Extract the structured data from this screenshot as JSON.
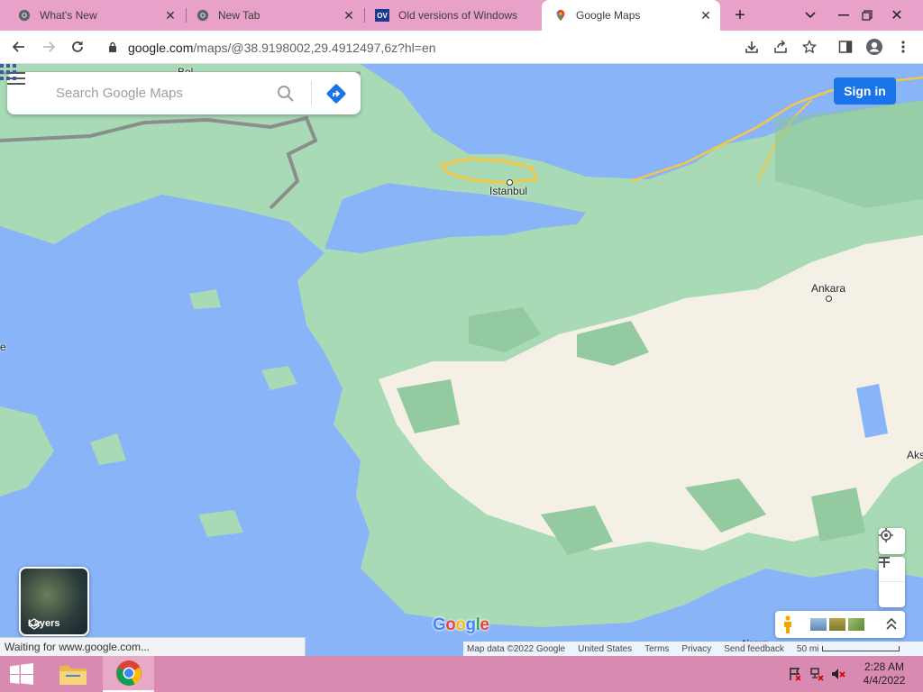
{
  "browser": {
    "tabs": [
      {
        "title": "What's New",
        "icon": "chrome-icon",
        "active": false
      },
      {
        "title": "New Tab",
        "icon": "chrome-icon",
        "active": false
      },
      {
        "title": "Old versions of Windows",
        "icon": "ov-icon",
        "active": false
      },
      {
        "title": "Google Maps",
        "icon": "maps-pin-icon",
        "active": true
      }
    ],
    "ov_badge": "OV",
    "address": {
      "host": "google.com",
      "path": "/maps/@38.9198002,29.4912497,6z?hl=en"
    }
  },
  "maps": {
    "search_placeholder": "Search Google Maps",
    "sign_in_label": "Sign in",
    "cities": [
      {
        "name": "Istanbul"
      },
      {
        "name": "Ankara"
      },
      {
        "name": "Aks"
      },
      {
        "name": "e"
      }
    ],
    "partial_label_top": "Bel",
    "alanya_label": "Alanya",
    "layers_label": "Layers",
    "logo_text": "Google",
    "footer": {
      "map_data": "Map data ©2022 Google",
      "region": "United States",
      "terms": "Terms",
      "privacy": "Privacy",
      "feedback": "Send feedback",
      "scale": "50 mi"
    },
    "status_text": "Waiting for www.google.com...",
    "colors": {
      "water": "#8ab4f8",
      "land_green": "#a8dab5",
      "land_beige": "#f5f0e6",
      "sign_in_blue": "#1a73e8"
    }
  },
  "taskbar": {
    "time": "2:28 AM",
    "date": "4/4/2022"
  }
}
